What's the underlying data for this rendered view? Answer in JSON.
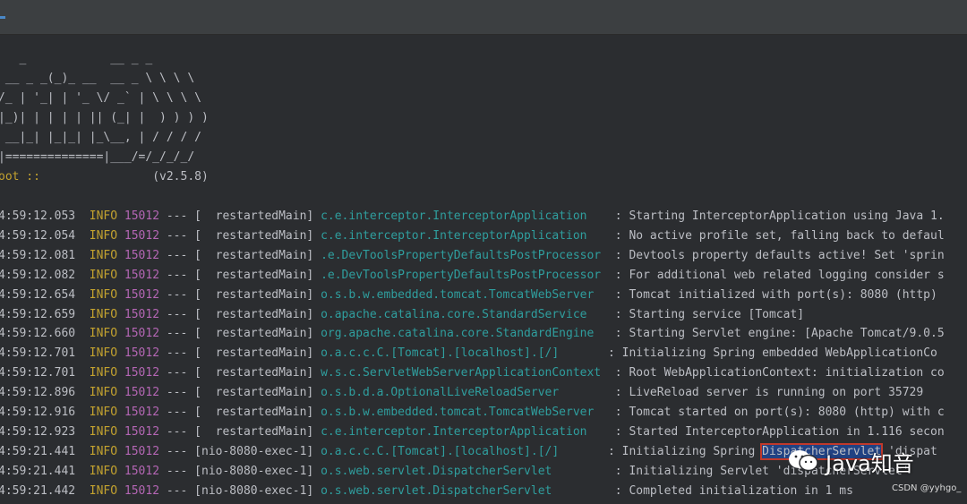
{
  "banner": {
    "lines": [
      "   _            __ _ _",
      " __ _ _(_)_ __  __ _ \\ \\ \\ \\",
      "/_ | '_| | '_ \\/ _` | \\ \\ \\ \\",
      "|_)| | | | | || (_| |  ) ) ) )",
      " __|_| |_|_| |_\\__, | / / / /",
      "|==============|___/=/_/_/_/"
    ],
    "spring_label": "oot ::",
    "version": "(v2.5.8)"
  },
  "log": [
    {
      "time": "4:59:12.053",
      "level": "INFO",
      "pid": "15012",
      "dash": "---",
      "thread": "[  restartedMain]",
      "logger": "c.e.interceptor.InterceptorApplication   ",
      "message": ": Starting InterceptorApplication using Java 1."
    },
    {
      "time": "4:59:12.054",
      "level": "INFO",
      "pid": "15012",
      "dash": "---",
      "thread": "[  restartedMain]",
      "logger": "c.e.interceptor.InterceptorApplication   ",
      "message": ": No active profile set, falling back to defaul"
    },
    {
      "time": "4:59:12.081",
      "level": "INFO",
      "pid": "15012",
      "dash": "---",
      "thread": "[  restartedMain]",
      "logger": ".e.DevToolsPropertyDefaultsPostProcessor ",
      "message": ": Devtools property defaults active! Set 'sprin"
    },
    {
      "time": "4:59:12.082",
      "level": "INFO",
      "pid": "15012",
      "dash": "---",
      "thread": "[  restartedMain]",
      "logger": ".e.DevToolsPropertyDefaultsPostProcessor ",
      "message": ": For additional web related logging consider s"
    },
    {
      "time": "4:59:12.654",
      "level": "INFO",
      "pid": "15012",
      "dash": "---",
      "thread": "[  restartedMain]",
      "logger": "o.s.b.w.embedded.tomcat.TomcatWebServer  ",
      "message": ": Tomcat initialized with port(s): 8080 (http)"
    },
    {
      "time": "4:59:12.659",
      "level": "INFO",
      "pid": "15012",
      "dash": "---",
      "thread": "[  restartedMain]",
      "logger": "o.apache.catalina.core.StandardService   ",
      "message": ": Starting service [Tomcat]"
    },
    {
      "time": "4:59:12.660",
      "level": "INFO",
      "pid": "15012",
      "dash": "---",
      "thread": "[  restartedMain]",
      "logger": "org.apache.catalina.core.StandardEngine  ",
      "message": ": Starting Servlet engine: [Apache Tomcat/9.0.5"
    },
    {
      "time": "4:59:12.701",
      "level": "INFO",
      "pid": "15012",
      "dash": "---",
      "thread": "[  restartedMain]",
      "logger": "o.a.c.c.C.[Tomcat].[localhost].[/]      ",
      "message": ": Initializing Spring embedded WebApplicationCo"
    },
    {
      "time": "4:59:12.701",
      "level": "INFO",
      "pid": "15012",
      "dash": "---",
      "thread": "[  restartedMain]",
      "logger": "w.s.c.ServletWebServerApplicationContext ",
      "message": ": Root WebApplicationContext: initialization co"
    },
    {
      "time": "4:59:12.896",
      "level": "INFO",
      "pid": "15012",
      "dash": "---",
      "thread": "[  restartedMain]",
      "logger": "o.s.b.d.a.OptionalLiveReloadServer       ",
      "message": ": LiveReload server is running on port 35729"
    },
    {
      "time": "4:59:12.916",
      "level": "INFO",
      "pid": "15012",
      "dash": "---",
      "thread": "[  restartedMain]",
      "logger": "o.s.b.w.embedded.tomcat.TomcatWebServer  ",
      "message": ": Tomcat started on port(s): 8080 (http) with c"
    },
    {
      "time": "4:59:12.923",
      "level": "INFO",
      "pid": "15012",
      "dash": "---",
      "thread": "[  restartedMain]",
      "logger": "c.e.interceptor.InterceptorApplication   ",
      "message": ": Started InterceptorApplication in 1.116 secon"
    },
    {
      "time": "4:59:21.441",
      "level": "INFO",
      "pid": "15012",
      "dash": "---",
      "thread": "[nio-8080-exec-1]",
      "logger": "o.a.c.c.C.[Tomcat].[localhost].[/]      ",
      "message": ": Initializing Spring ",
      "highlight": "DispatcherServlet",
      "message_after": " 'dispat"
    },
    {
      "time": "4:59:21.441",
      "level": "INFO",
      "pid": "15012",
      "dash": "---",
      "thread": "[nio-8080-exec-1]",
      "logger": "o.s.web.servlet.DispatcherServlet        ",
      "message": ": Initializing Servlet 'dispatcherServlet'"
    },
    {
      "time": "4:59:21.442",
      "level": "INFO",
      "pid": "15012",
      "dash": "---",
      "thread": "[nio-8080-exec-1]",
      "logger": "o.s.web.servlet.DispatcherServlet        ",
      "message": ": Completed initialization in 1 ms"
    }
  ],
  "watermark": {
    "icon": "wechat-icon",
    "text": "Java知音"
  },
  "credit": "CSDN @yyhgo_",
  "colors": {
    "background": "#2b2d30",
    "level": "#c3a22f",
    "pid": "#b466b4",
    "logger": "#2f9e9e",
    "highlight": "#214283"
  }
}
